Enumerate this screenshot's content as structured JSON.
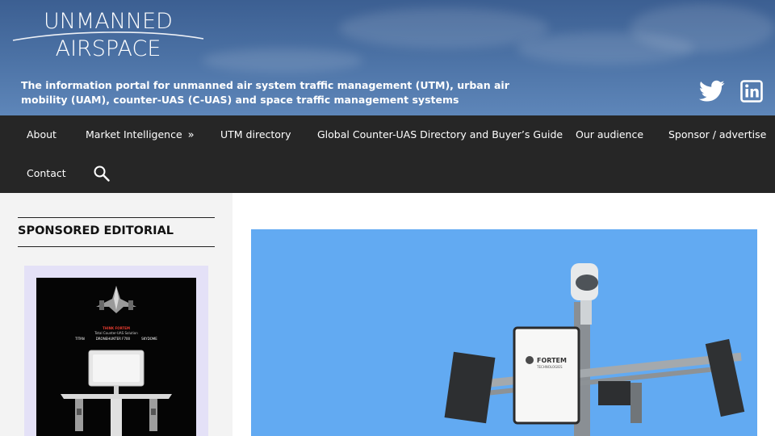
{
  "brand": {
    "logo_line1": "UNMANNED",
    "logo_line2": "AIRSPACE",
    "tagline": "The information portal for unmanned air system traffic management (UTM), urban air mobility (UAM), counter-UAS (C-UAS) and space traffic management systems"
  },
  "social": {
    "twitter_icon": "twitter-icon",
    "linkedin_icon": "linkedin-icon"
  },
  "nav": {
    "items": [
      {
        "label": "About"
      },
      {
        "label": "Market Intelligence",
        "chevron": "»"
      },
      {
        "label": "UTM directory"
      },
      {
        "label": "Global Counter-UAS Directory and Buyer’s Guide"
      },
      {
        "label": "Our audience"
      },
      {
        "label": "Sponsor / advertise"
      },
      {
        "label": "Contact"
      }
    ],
    "search_icon": "search-icon"
  },
  "sidebar": {
    "section_title": "SPONSORED EDITORIAL",
    "ad": {
      "headline": "THINK FORTEM",
      "subline": "Total Counter-UAS Solution",
      "products": [
        "TITAN",
        "DRONEHUNTER F700",
        "SKYDOME"
      ]
    }
  },
  "hero": {
    "sensor_brand": "FORTEM",
    "sensor_sub": "TECHNOLOGIES"
  },
  "colors": {
    "header_bg": "#4a70a3",
    "nav_bg": "#262626",
    "sidebar_bg": "#f3f3f3",
    "ad_border": "#e4e1f7",
    "sky": "#62aaf2"
  }
}
